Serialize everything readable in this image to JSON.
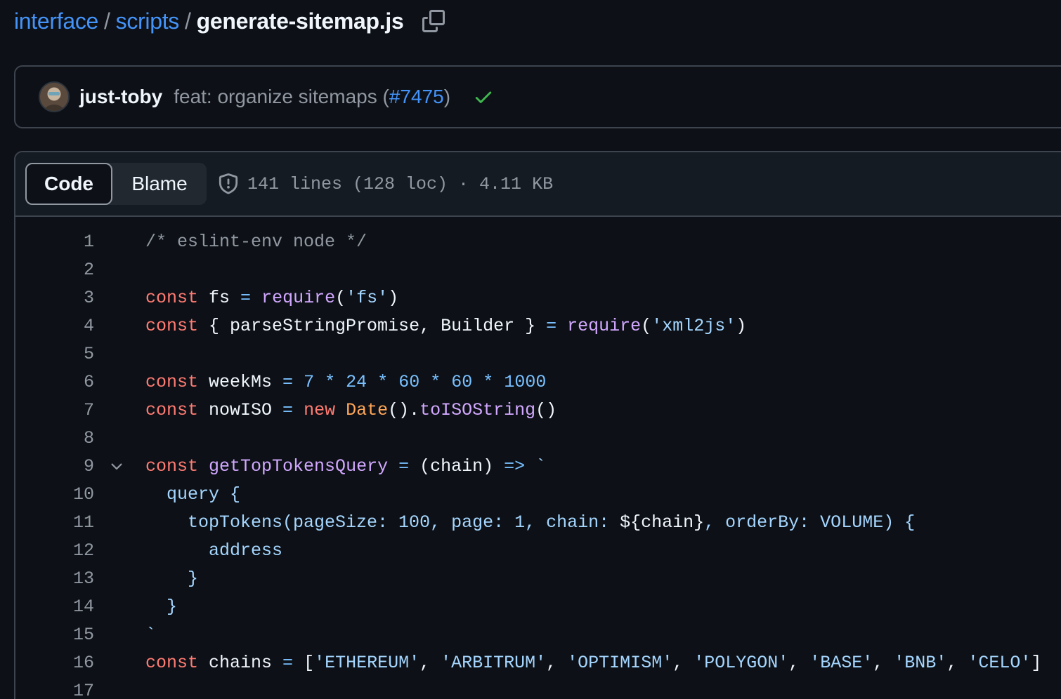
{
  "breadcrumb": {
    "repo": "interface",
    "folder": "scripts",
    "file": "generate-sitemap.js",
    "separator": "/"
  },
  "commit": {
    "author": "just-toby",
    "message_prefix": "feat: organize sitemaps (",
    "pr_number": "#7475",
    "message_suffix": ")",
    "status": "success"
  },
  "file_header": {
    "tabs": [
      {
        "label": "Code",
        "selected": true
      },
      {
        "label": "Blame",
        "selected": false
      }
    ],
    "meta": "141 lines (128 loc) · 4.11 KB"
  },
  "colors": {
    "background": "#0d1117",
    "link": "#4493f8",
    "success": "#3fb950",
    "keyword": "#ff7b72",
    "function": "#d2a8ff",
    "string": "#a5d6ff",
    "number": "#79c0ff",
    "class": "#ffa657",
    "comment": "#9198a1"
  },
  "icons": {
    "copy": "copy-icon",
    "check": "check-icon",
    "shield": "shield-icon",
    "fold": "chevron-down-icon"
  },
  "code_lines": [
    {
      "n": "1",
      "fold": false,
      "tokens": [
        [
          "c",
          "/* eslint-env node */"
        ]
      ]
    },
    {
      "n": "2",
      "fold": false,
      "tokens": []
    },
    {
      "n": "3",
      "fold": false,
      "tokens": [
        [
          "k",
          "const"
        ],
        [
          "p",
          " fs "
        ],
        [
          "o",
          "="
        ],
        [
          "p",
          " "
        ],
        [
          "f",
          "require"
        ],
        [
          "p",
          "("
        ],
        [
          "s",
          "'fs'"
        ],
        [
          "p",
          ")"
        ]
      ]
    },
    {
      "n": "4",
      "fold": false,
      "tokens": [
        [
          "k",
          "const"
        ],
        [
          "p",
          " { parseStringPromise, Builder } "
        ],
        [
          "o",
          "="
        ],
        [
          "p",
          " "
        ],
        [
          "f",
          "require"
        ],
        [
          "p",
          "("
        ],
        [
          "s",
          "'xml2js'"
        ],
        [
          "p",
          ")"
        ]
      ]
    },
    {
      "n": "5",
      "fold": false,
      "tokens": []
    },
    {
      "n": "6",
      "fold": false,
      "tokens": [
        [
          "k",
          "const"
        ],
        [
          "p",
          " weekMs "
        ],
        [
          "o",
          "="
        ],
        [
          "p",
          " "
        ],
        [
          "n",
          "7"
        ],
        [
          "p",
          " "
        ],
        [
          "o",
          "*"
        ],
        [
          "p",
          " "
        ],
        [
          "n",
          "24"
        ],
        [
          "p",
          " "
        ],
        [
          "o",
          "*"
        ],
        [
          "p",
          " "
        ],
        [
          "n",
          "60"
        ],
        [
          "p",
          " "
        ],
        [
          "o",
          "*"
        ],
        [
          "p",
          " "
        ],
        [
          "n",
          "60"
        ],
        [
          "p",
          " "
        ],
        [
          "o",
          "*"
        ],
        [
          "p",
          " "
        ],
        [
          "n",
          "1000"
        ]
      ]
    },
    {
      "n": "7",
      "fold": false,
      "tokens": [
        [
          "k",
          "const"
        ],
        [
          "p",
          " nowISO "
        ],
        [
          "o",
          "="
        ],
        [
          "p",
          " "
        ],
        [
          "k",
          "new"
        ],
        [
          "p",
          " "
        ],
        [
          "y",
          "Date"
        ],
        [
          "p",
          "()."
        ],
        [
          "f",
          "toISOString"
        ],
        [
          "p",
          "()"
        ]
      ]
    },
    {
      "n": "8",
      "fold": false,
      "tokens": []
    },
    {
      "n": "9",
      "fold": true,
      "tokens": [
        [
          "k",
          "const"
        ],
        [
          "p",
          " "
        ],
        [
          "f",
          "getTopTokensQuery"
        ],
        [
          "p",
          " "
        ],
        [
          "o",
          "="
        ],
        [
          "p",
          " (chain) "
        ],
        [
          "o",
          "=>"
        ],
        [
          "p",
          " "
        ],
        [
          "s",
          "`"
        ]
      ]
    },
    {
      "n": "10",
      "fold": false,
      "tokens": [
        [
          "s",
          "  query {"
        ]
      ]
    },
    {
      "n": "11",
      "fold": false,
      "tokens": [
        [
          "s",
          "    topTokens(pageSize: 100, page: 1, chain: "
        ],
        [
          "p",
          "${chain}"
        ],
        [
          "s",
          ", orderBy: VOLUME) {"
        ]
      ]
    },
    {
      "n": "12",
      "fold": false,
      "tokens": [
        [
          "s",
          "      address"
        ]
      ]
    },
    {
      "n": "13",
      "fold": false,
      "tokens": [
        [
          "s",
          "    }"
        ]
      ]
    },
    {
      "n": "14",
      "fold": false,
      "tokens": [
        [
          "s",
          "  }"
        ]
      ]
    },
    {
      "n": "15",
      "fold": false,
      "tokens": [
        [
          "s",
          "`"
        ]
      ]
    },
    {
      "n": "16",
      "fold": false,
      "tokens": [
        [
          "k",
          "const"
        ],
        [
          "p",
          " chains "
        ],
        [
          "o",
          "="
        ],
        [
          "p",
          " ["
        ],
        [
          "s",
          "'ETHEREUM'"
        ],
        [
          "p",
          ", "
        ],
        [
          "s",
          "'ARBITRUM'"
        ],
        [
          "p",
          ", "
        ],
        [
          "s",
          "'OPTIMISM'"
        ],
        [
          "p",
          ", "
        ],
        [
          "s",
          "'POLYGON'"
        ],
        [
          "p",
          ", "
        ],
        [
          "s",
          "'BASE'"
        ],
        [
          "p",
          ", "
        ],
        [
          "s",
          "'BNB'"
        ],
        [
          "p",
          ", "
        ],
        [
          "s",
          "'CELO'"
        ],
        [
          "p",
          "]"
        ]
      ]
    },
    {
      "n": "17",
      "fold": false,
      "tokens": []
    }
  ]
}
